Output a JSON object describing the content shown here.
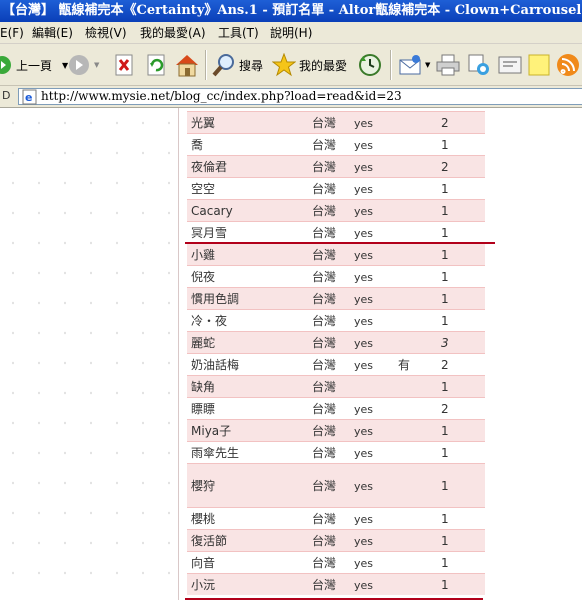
{
  "window": {
    "title": "【台灣】 甑線補完本《Certainty》Ans.1 - 預訂名單 - Altor甑線補完本 - Clown+Carrousel - Microsoft Inter"
  },
  "menu": [
    "E(F)",
    "編輯(E)",
    "檢視(V)",
    "我的最愛(A)",
    "工具(T)",
    "說明(H)"
  ],
  "toolbar": {
    "back_label": "上一頁",
    "search_label": "搜尋",
    "favorites_label": "我的最愛"
  },
  "address": {
    "label": "D",
    "url": "http://www.mysie.net/blog_cc/index.php?load=read&id=23"
  },
  "colors": {
    "row_pink": "#f9e4e4",
    "row_border": "#f2c2c2",
    "underline_red": "#b2001a",
    "title_blue": "#0a3fb8"
  },
  "table": {
    "rows": [
      {
        "name": "光翼",
        "location": "台灣",
        "yes": "yes",
        "extra": "",
        "count": "2"
      },
      {
        "name": "喬",
        "location": "台灣",
        "yes": "yes",
        "extra": "",
        "count": "1"
      },
      {
        "name": "夜倫君",
        "location": "台灣",
        "yes": "yes",
        "extra": "",
        "count": "2"
      },
      {
        "name": "空空",
        "location": "台灣",
        "yes": "yes",
        "extra": "",
        "count": "1"
      },
      {
        "name": "Cacary",
        "location": "台灣",
        "yes": "yes",
        "extra": "",
        "count": "1"
      },
      {
        "name": "冥月雪",
        "location": "台灣",
        "yes": "yes",
        "extra": "",
        "count": "1"
      },
      {
        "name": "小雞",
        "location": "台灣",
        "yes": "yes",
        "extra": "",
        "count": "1"
      },
      {
        "name": "倪夜",
        "location": "台灣",
        "yes": "yes",
        "extra": "",
        "count": "1"
      },
      {
        "name": "慣用色調",
        "location": "台灣",
        "yes": "yes",
        "extra": "",
        "count": "1"
      },
      {
        "name": "冷・夜",
        "location": "台灣",
        "yes": "yes",
        "extra": "",
        "count": "1"
      },
      {
        "name": "麗蛇",
        "location": "台灣",
        "yes": "yes",
        "extra": "",
        "count": "3"
      },
      {
        "name": "奶油話梅",
        "location": "台灣",
        "yes": "yes",
        "extra": "有",
        "count": "2"
      },
      {
        "name": "缺角",
        "location": "台灣",
        "yes": "",
        "extra": "",
        "count": "1"
      },
      {
        "name": "瞟瞟",
        "location": "台灣",
        "yes": "yes",
        "extra": "",
        "count": "2"
      },
      {
        "name": "Miya子",
        "location": "台灣",
        "yes": "yes",
        "extra": "",
        "count": "1"
      },
      {
        "name": "雨傘先生",
        "location": "台灣",
        "yes": "yes",
        "extra": "",
        "count": "1"
      },
      {
        "name": "櫻狩",
        "location": "台灣",
        "yes": "yes",
        "extra": "",
        "count": "1"
      },
      {
        "name": "櫻桃",
        "location": "台灣",
        "yes": "yes",
        "extra": "",
        "count": "1"
      },
      {
        "name": "復活節",
        "location": "台灣",
        "yes": "yes",
        "extra": "",
        "count": "1"
      },
      {
        "name": "向音",
        "location": "台灣",
        "yes": "yes",
        "extra": "",
        "count": "1"
      },
      {
        "name": "小沅",
        "location": "台灣",
        "yes": "yes",
        "extra": "",
        "count": "1"
      }
    ]
  }
}
